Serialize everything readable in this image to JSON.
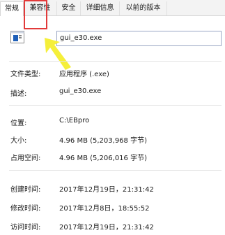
{
  "tabs": [
    {
      "label": "常规"
    },
    {
      "label": "兼容性"
    },
    {
      "label": "安全"
    },
    {
      "label": "详细信息"
    },
    {
      "label": "以前的版本"
    }
  ],
  "file_name": "gui_e30.exe",
  "rows": {
    "file_type": {
      "label": "文件类型:",
      "value": "应用程序 (.exe)"
    },
    "description": {
      "label": "描述:",
      "value": "gui_e30.exe"
    },
    "location": {
      "label": "位置:",
      "value": "C:\\EBpro"
    },
    "size": {
      "label": "大小:",
      "value": "4.96 MB (5,203,968 字节)"
    },
    "size_on_disk": {
      "label": "占用空间:",
      "value": "4.96 MB (5,206,016 字节)"
    },
    "created": {
      "label": "创建时间:",
      "value": "2017年12月19日，21:31:42"
    },
    "modified": {
      "label": "修改时间:",
      "value": "2017年12月8日，18:55:52"
    },
    "accessed": {
      "label": "访问时间:",
      "value": "2017年12月19日，21:31:42"
    }
  },
  "colors": {
    "highlight_box": "#e23a3a",
    "arrow": "#f5ef3a",
    "icon_blue": "#1f5fb8"
  },
  "icons": {
    "file": "exe-file-icon",
    "pointer": "yellow-arrow-annotation"
  }
}
